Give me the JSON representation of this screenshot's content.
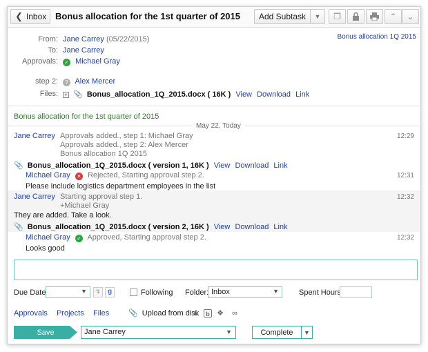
{
  "toolbar": {
    "back_label": "Inbox",
    "title": "Bonus allocation for the 1st quarter of 2015",
    "add_subtask_label": "Add Subtask"
  },
  "header": {
    "from_label": "From:",
    "from_name": "Jane Carrey",
    "from_date": "(05/22/2015)",
    "to_label": "To:",
    "to_name": "Jane Carrey",
    "approvals_label": "Approvals:",
    "approver_1": "Michael Gray",
    "step2_label": "step 2:",
    "approver_2": "Alex Mercer",
    "files_label": "Files:",
    "file_name": "Bonus_allocation_1Q_2015.docx ( 16K )",
    "view": "View",
    "download": "Download",
    "link": "Link",
    "tag_link": "Bonus allocation 1Q 2015"
  },
  "subject": "Bonus allocation for the 1st quarter of 2015",
  "date_divider": "May 22, Today",
  "activity": {
    "entry1": {
      "author": "Jane Carrey",
      "line1": "Approvals added., step 1: Michael Gray",
      "line2": "Approvals added., step 2: Alex Mercer",
      "line3": "Bonus allocation 1Q 2015",
      "time": "12:29",
      "file": "Bonus_allocation_1Q_2015.docx ( version 1, 16K )"
    },
    "entry2": {
      "author": "Michael Gray",
      "status": "Rejected",
      "status_rest": ", Starting approval step 2.",
      "time": "12:31",
      "message": "Please include logistics department employees in the list"
    },
    "entry3": {
      "author": "Jane Carrey",
      "line1": "Starting approval step 1.",
      "line2": "+Michael Gray",
      "time": "12:32",
      "message": "They are added. Take a look.",
      "file": "Bonus_allocation_1Q_2015.docx ( version 2, 16K )"
    },
    "entry4": {
      "author": "Michael Gray",
      "status": "Approved",
      "status_rest": ", Starting approval step 2.",
      "time": "12:32",
      "message": "Looks good"
    }
  },
  "form": {
    "due_date_label": "Due Date:",
    "following_label": "Following",
    "folder_label": "Folder:",
    "folder_value": "Inbox",
    "spent_hours_label": "Spent Hours:"
  },
  "bottom_tabs": {
    "approvals": "Approvals",
    "projects": "Projects",
    "files": "Files",
    "upload": "Upload from disk"
  },
  "actions": {
    "save": "Save",
    "assignee": "Jane Carrey",
    "complete": "Complete"
  },
  "colors": {
    "accent": "#3aaea3",
    "link": "#1f3fb5",
    "subject_green": "#2d7a2a",
    "approved": "#2aa83a",
    "rejected": "#d23a3a"
  }
}
